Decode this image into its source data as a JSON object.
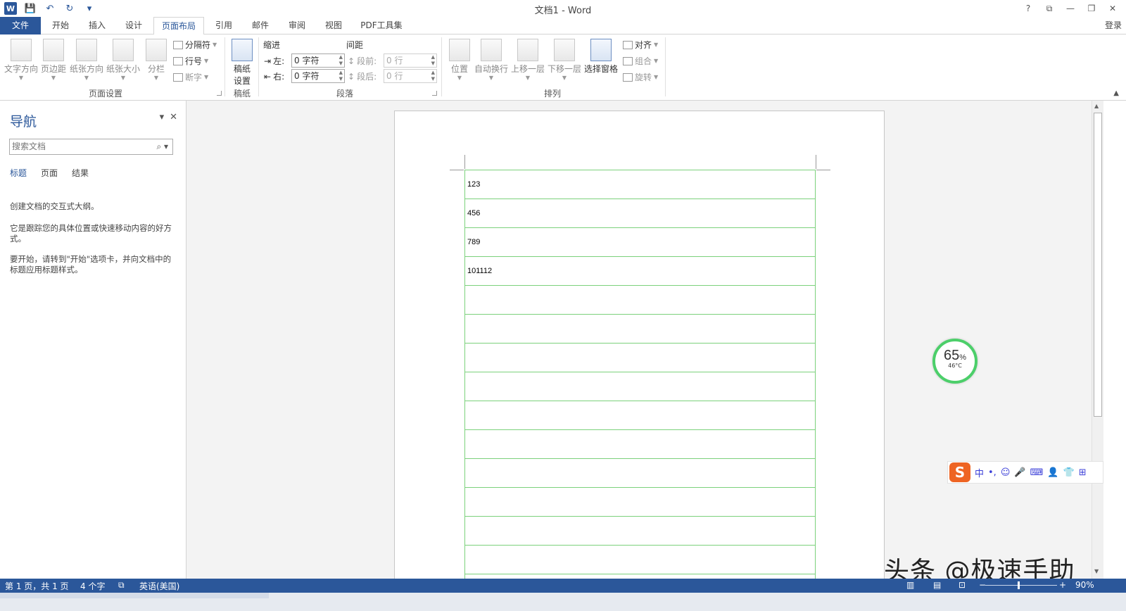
{
  "titlebar": {
    "title": "文档1 - Word",
    "word_logo": "W",
    "controls": [
      "?",
      "⧉",
      "—",
      "❐",
      "✕"
    ]
  },
  "tabs": {
    "file": "文件",
    "items": [
      "开始",
      "插入",
      "设计",
      "页面布局",
      "引用",
      "邮件",
      "审阅",
      "视图",
      "PDF工具集"
    ],
    "active": "页面布局",
    "login": "登录"
  },
  "ribbon": {
    "page_setup": {
      "label": "页面设置",
      "text_direction": "文字方向",
      "margins": "页边距",
      "orientation": "纸张方向",
      "size": "纸张大小",
      "columns": "分栏",
      "breaks": "分隔符",
      "line_numbers": "行号",
      "hyphenation": "断字"
    },
    "manuscript": {
      "label": "稿纸",
      "button_line1": "稿纸",
      "button_line2": "设置"
    },
    "paragraph": {
      "label": "段落",
      "indent_header": "缩进",
      "spacing_header": "间距",
      "left_label": "左:",
      "right_label": "右:",
      "left_value": "0 字符",
      "right_value": "0 字符",
      "before_label": "段前:",
      "after_label": "段后:",
      "before_value": "0 行",
      "after_value": "0 行"
    },
    "arrange": {
      "label": "排列",
      "position": "位置",
      "wrap_text": "自动换行",
      "bring_forward": "上移一层",
      "send_backward": "下移一层",
      "selection_pane": "选择窗格",
      "align": "对齐",
      "group": "组合",
      "rotate": "旋转"
    }
  },
  "nav": {
    "title": "导航",
    "search_placeholder": "搜索文档",
    "tabs": [
      "标题",
      "页面",
      "结果"
    ],
    "text1": "创建文档的交互式大纲。",
    "text2": "它是跟踪您的具体位置或快速移动内容的好方式。",
    "text3": "要开始，请转到\"开始\"选项卡，并向文档中的标题应用标题样式。"
  },
  "document": {
    "rows": [
      "123",
      "456",
      "789",
      " 101112",
      "",
      "",
      "",
      "",
      "",
      "",
      "",
      "",
      "",
      "",
      ""
    ]
  },
  "widgets": {
    "gauge_percent": "65",
    "gauge_unit": "%",
    "gauge_temp": "46°C",
    "ime_logo": "S",
    "ime_icons": [
      "中",
      "•,",
      "☺",
      "🎤",
      "⌨",
      "👤",
      "👕",
      "⊞"
    ],
    "watermark": "头条 @极速手助"
  },
  "statusbar": {
    "page": "第 1 页，共 1 页",
    "words": "4 个字",
    "language": "英语(美国)",
    "zoom": "90%",
    "zoom_minus": "−",
    "zoom_plus": "+"
  },
  "colors": {
    "accent": "#2b579a",
    "line_green": "#7cd17c",
    "gauge_green": "#4ccf6a",
    "ime_orange": "#ee6423"
  }
}
